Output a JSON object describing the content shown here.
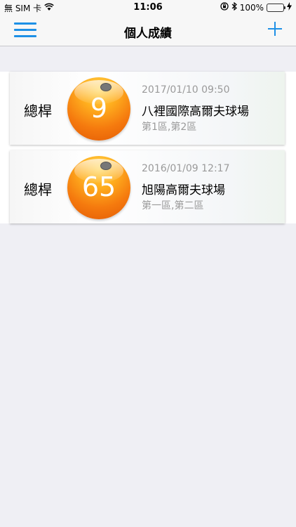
{
  "status_bar": {
    "carrier": "無 SIM 卡",
    "time": "11:06",
    "battery_percent": "100%",
    "battery_level": 1.0
  },
  "nav": {
    "title": "個人成績",
    "menu_icon": "hamburger-menu-icon",
    "add_icon": "plus-icon",
    "accent_color": "#1e90e6"
  },
  "rounds": [
    {
      "label": "總桿",
      "score": "9",
      "date": "2017/01/10 09:50",
      "course": "八裡國際高爾夫球場",
      "zones": "第1區,第2區"
    },
    {
      "label": "總桿",
      "score": "65",
      "date": "2016/01/09 12:17",
      "course": "旭陽高爾夫球場",
      "zones": "第一區,第二區"
    }
  ]
}
